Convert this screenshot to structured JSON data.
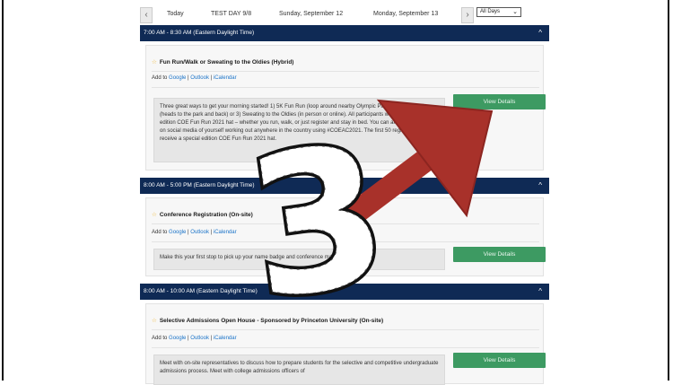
{
  "datenav": {
    "prev_icon": "chevron-left-icon",
    "next_icon": "chevron-right-icon",
    "today": "Today",
    "test_day": "TEST DAY 9/8",
    "sunday": "Sunday, September 12",
    "monday": "Monday, September 13",
    "filter_value": "All Days"
  },
  "sessions": [
    {
      "time": "7:00 AM - 8:30 AM (Eastern Daylight Time)",
      "title": "Fun Run/Walk or Sweating to the Oldies (Hybrid)",
      "add_to": "Add to",
      "google": "Google",
      "outlook": "Outlook",
      "ical": "iCalendar",
      "description": "Three great ways to get your morning started! 1) 5K Fun Run (loop around nearby Olympic Park) 2) 2-mile walk (heads to the park and back) or 3) Sweating to the Oldies (in person or online). All participants will receive a special edition COE Fun Run 2021 hat – whether you run, walk, or just register and stay in bed. You can also share a selfie on social media of yourself working out anywhere in the country using #COEAC2021. The first 50 registrants will receive a special edition COE Fun Run 2021 hat.",
      "button": "View Details"
    },
    {
      "time": "8:00 AM - 5:00 PM (Eastern Daylight Time)",
      "title": "Conference Registration (On-site)",
      "add_to": "Add to",
      "google": "Google",
      "outlook": "Outlook",
      "ical": "iCalendar",
      "description": "Make this your first stop to pick up your name badge and conference materials!",
      "button": "View Details"
    },
    {
      "time": "8:00 AM - 10:00 AM (Eastern Daylight Time)",
      "title": "Selective Admissions Open House - Sponsored by Princeton University (On-site)",
      "add_to": "Add to",
      "google": "Google",
      "outlook": "Outlook",
      "ical": "iCalendar",
      "description": "Meet with on-site representatives to discuss how to prepare students for the selective and competitive undergraduate admissions process. Meet with college admissions officers of",
      "button": "View Details"
    }
  ],
  "overlay": {
    "numeral": "3",
    "arrow_color": "#a8312a"
  }
}
